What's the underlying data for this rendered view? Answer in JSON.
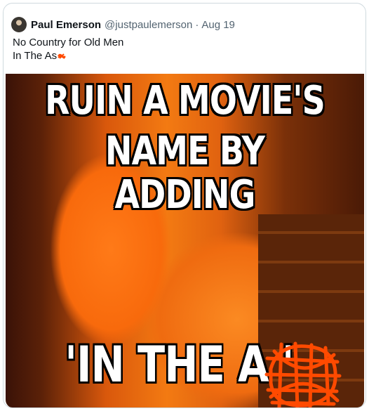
{
  "tweet": {
    "author_name": "Paul Emerson",
    "handle": "@justpaulemerson",
    "separator": "·",
    "date": "Aug 19",
    "line1": "No Country for Old Men",
    "line2": "In The As",
    "icons": {
      "avatar": "avatar-photo",
      "censor": "orange-scribble"
    }
  },
  "meme": {
    "top_line1": "RUIN A MOVIE'S",
    "top_line2": "NAME BY ADDING",
    "bottom_line": "'IN THE A    '"
  },
  "colors": {
    "scribble": "#ff4a00",
    "name": "#0f1419",
    "muted": "#536471"
  }
}
